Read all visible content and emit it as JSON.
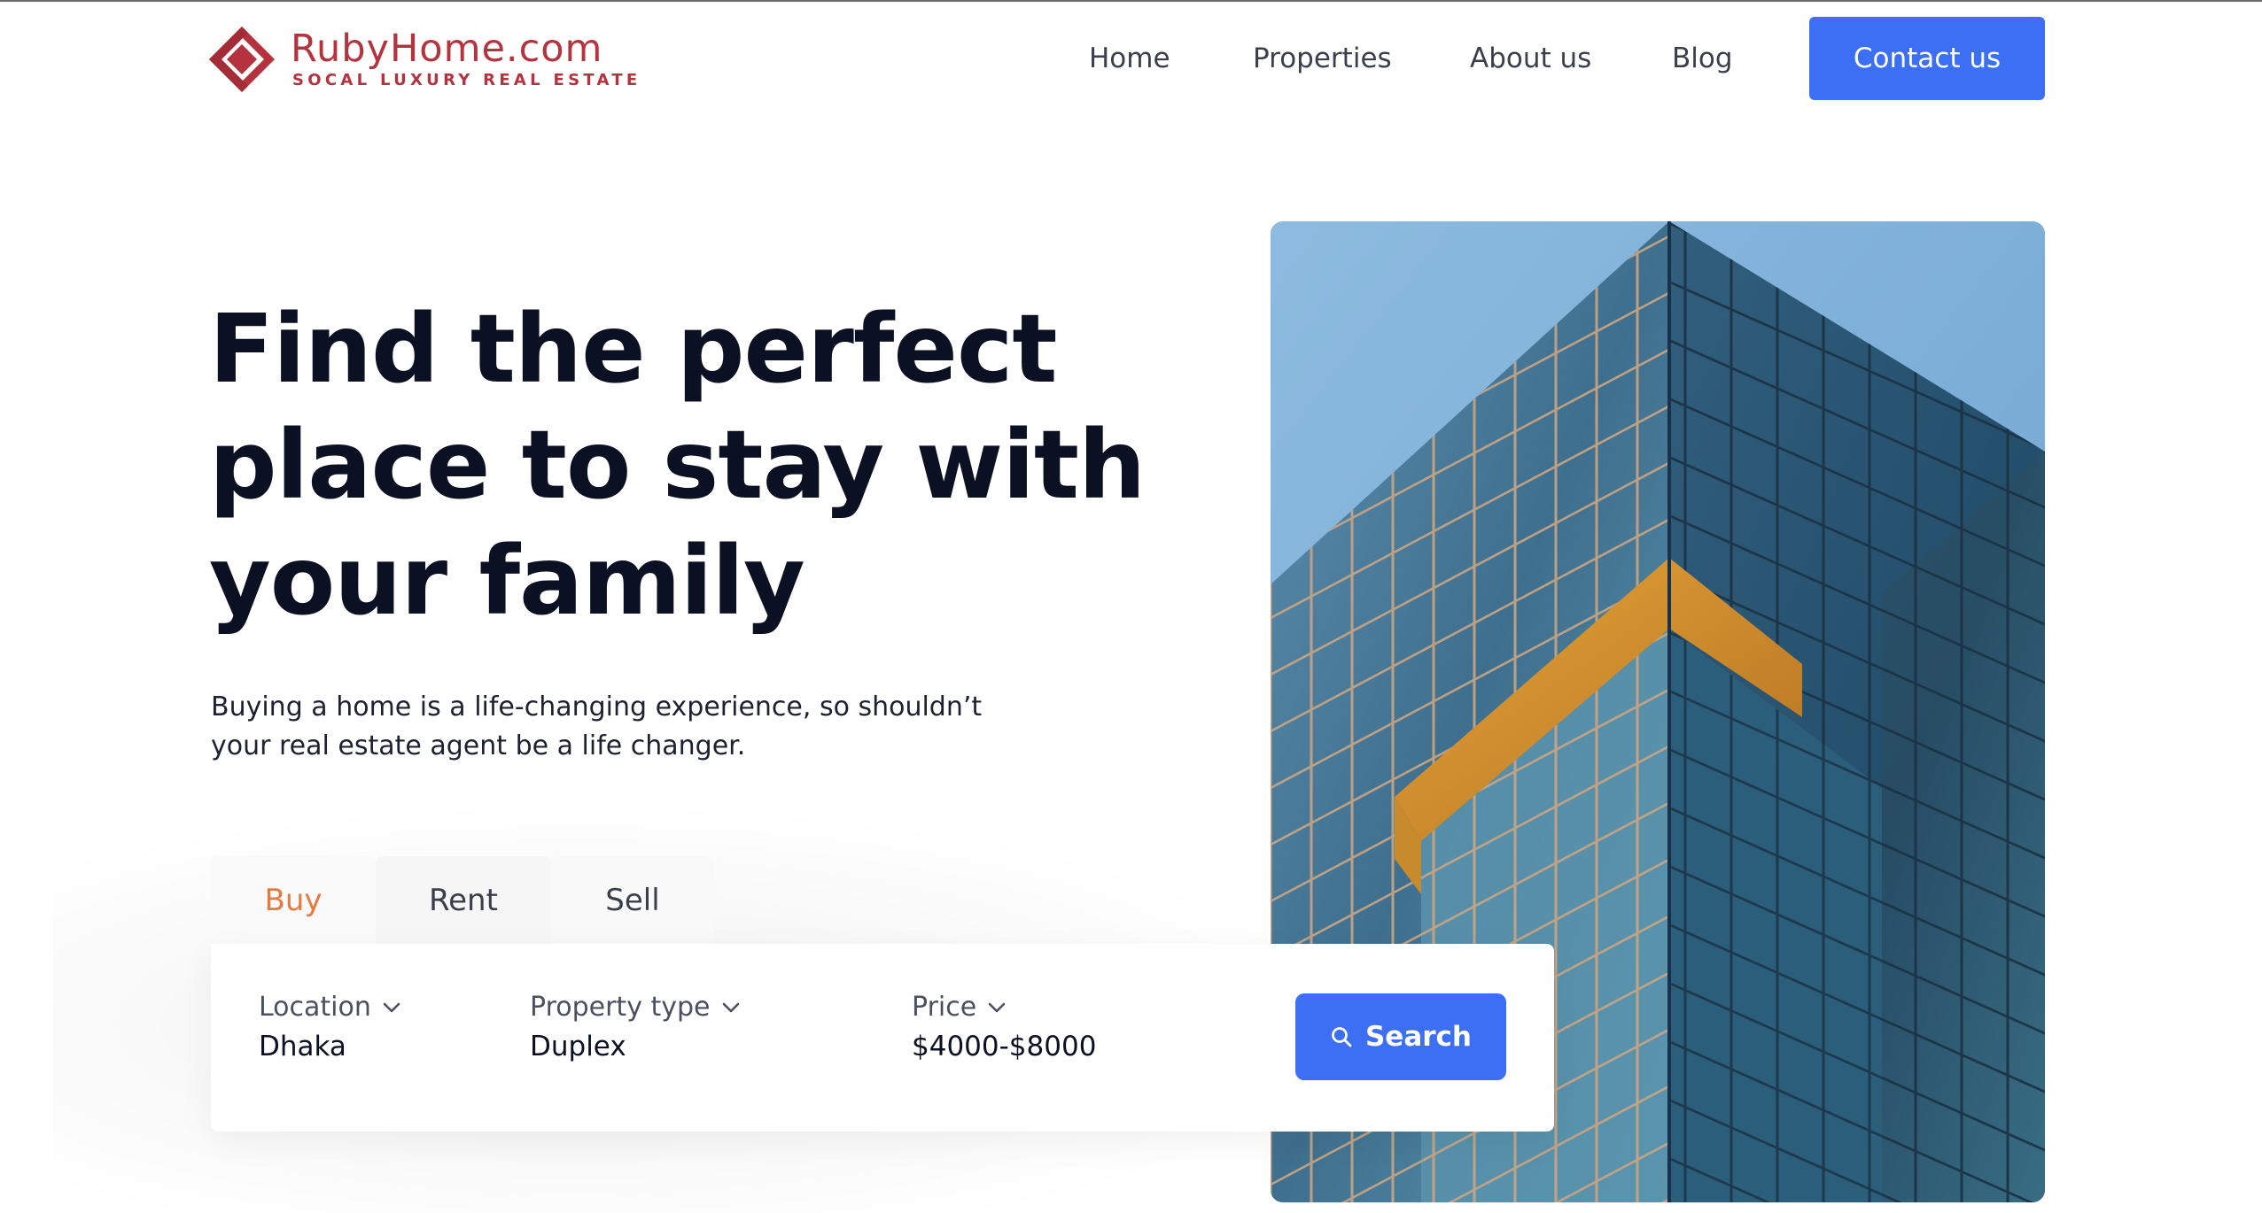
{
  "brand": {
    "name": "RubyHome.com",
    "tagline": "SOCAL LUXURY REAL ESTATE",
    "color": "#b5333f"
  },
  "nav": {
    "items": [
      {
        "label": "Home"
      },
      {
        "label": "Properties"
      },
      {
        "label": "About us"
      },
      {
        "label": "Blog"
      }
    ],
    "cta_label": "Contact us"
  },
  "hero": {
    "title_lines": [
      "Find the perfect",
      "place to stay with",
      "your family"
    ],
    "subtitle_lines": [
      "Buying a home is a life-changing experience, so shouldn’t",
      "your real estate agent be a life changer."
    ]
  },
  "search": {
    "tabs": [
      {
        "label": "Buy",
        "active": true
      },
      {
        "label": "Rent",
        "active": false
      },
      {
        "label": "Sell",
        "active": false
      }
    ],
    "fields": {
      "location": {
        "label": "Location",
        "value": "Dhaka",
        "icon": "chevron-down-icon"
      },
      "property_type": {
        "label": "Property type",
        "value": "Duplex",
        "icon": "chevron-down-icon"
      },
      "price": {
        "label": "Price",
        "value": "$4000-$8000",
        "icon": "chevron-down-icon"
      }
    },
    "button_label": "Search",
    "button_icon": "search-icon"
  },
  "colors": {
    "accent": "#3d6ff5",
    "active_tab": "#e77a3f",
    "heading": "#0b1023"
  }
}
